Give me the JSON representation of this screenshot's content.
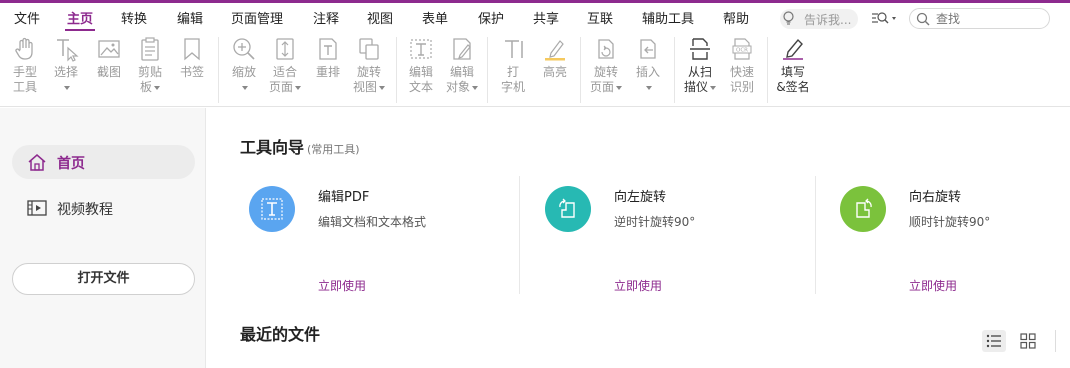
{
  "menu": {
    "items": [
      "文件",
      "主页",
      "转换",
      "编辑",
      "页面管理",
      "注释",
      "视图",
      "表单",
      "保护",
      "共享",
      "互联",
      "辅助工具",
      "帮助"
    ],
    "active": "主页",
    "tell_me_placeholder": "告诉我...",
    "search_placeholder": "查找"
  },
  "ribbon": {
    "tools": [
      {
        "label": "手型\n工具",
        "icon": "hand-icon",
        "enabled": false
      },
      {
        "label": "选择",
        "icon": "select-text-icon",
        "enabled": false,
        "dropdown": true
      },
      {
        "label": "截图",
        "icon": "snapshot-icon",
        "enabled": false
      },
      {
        "label": "剪贴\n板",
        "icon": "clipboard-icon",
        "enabled": false,
        "dropdown": true
      },
      {
        "label": "书签",
        "icon": "bookmark-icon",
        "enabled": false
      },
      {
        "label": "缩放",
        "icon": "zoom-icon",
        "enabled": false,
        "dropdown": true
      },
      {
        "label": "适合\n页面",
        "icon": "fit-page-icon",
        "enabled": false,
        "dropdown": true
      },
      {
        "label": "重排",
        "icon": "reflow-icon",
        "enabled": false
      },
      {
        "label": "旋转\n视图",
        "icon": "rotate-view-icon",
        "enabled": false,
        "dropdown": true
      },
      {
        "label": "编辑\n文本",
        "icon": "edit-text-icon",
        "enabled": false
      },
      {
        "label": "编辑\n对象",
        "icon": "edit-object-icon",
        "enabled": false,
        "dropdown": true
      },
      {
        "label": "打\n字机",
        "icon": "typewriter-icon",
        "enabled": false
      },
      {
        "label": "高亮",
        "icon": "highlight-icon",
        "enabled": false
      },
      {
        "label": "旋转\n页面",
        "icon": "rotate-page-icon",
        "enabled": false,
        "dropdown": true
      },
      {
        "label": "插入",
        "icon": "insert-page-icon",
        "enabled": false,
        "dropdown": true
      },
      {
        "label": "从扫\n描仪",
        "icon": "scanner-icon",
        "enabled": true,
        "dropdown": true
      },
      {
        "label": "快速\n识别",
        "icon": "ocr-icon",
        "enabled": false
      },
      {
        "label": "填写\n&签名",
        "icon": "fill-sign-icon",
        "enabled": true
      }
    ]
  },
  "sidebar": {
    "home": "首页",
    "video": "视频教程",
    "open_file": "打开文件"
  },
  "main": {
    "tool_wizard_title": "工具向导",
    "tool_wizard_subtitle": "(常用工具)",
    "cards": [
      {
        "title": "编辑PDF",
        "desc": "编辑文档和文本格式",
        "link": "立即使用",
        "color": "#5aa5f0",
        "icon": "edit-pdf-icon"
      },
      {
        "title": "向左旋转",
        "desc": "逆时针旋转90°",
        "link": "立即使用",
        "color": "#27b9b3",
        "icon": "rotate-left-icon"
      },
      {
        "title": "向右旋转",
        "desc": "顺时针旋转90°",
        "link": "立即使用",
        "color": "#7bc23c",
        "icon": "rotate-right-icon"
      }
    ],
    "recent_title": "最近的文件"
  },
  "colors": {
    "accent": "#8d2a8e"
  }
}
